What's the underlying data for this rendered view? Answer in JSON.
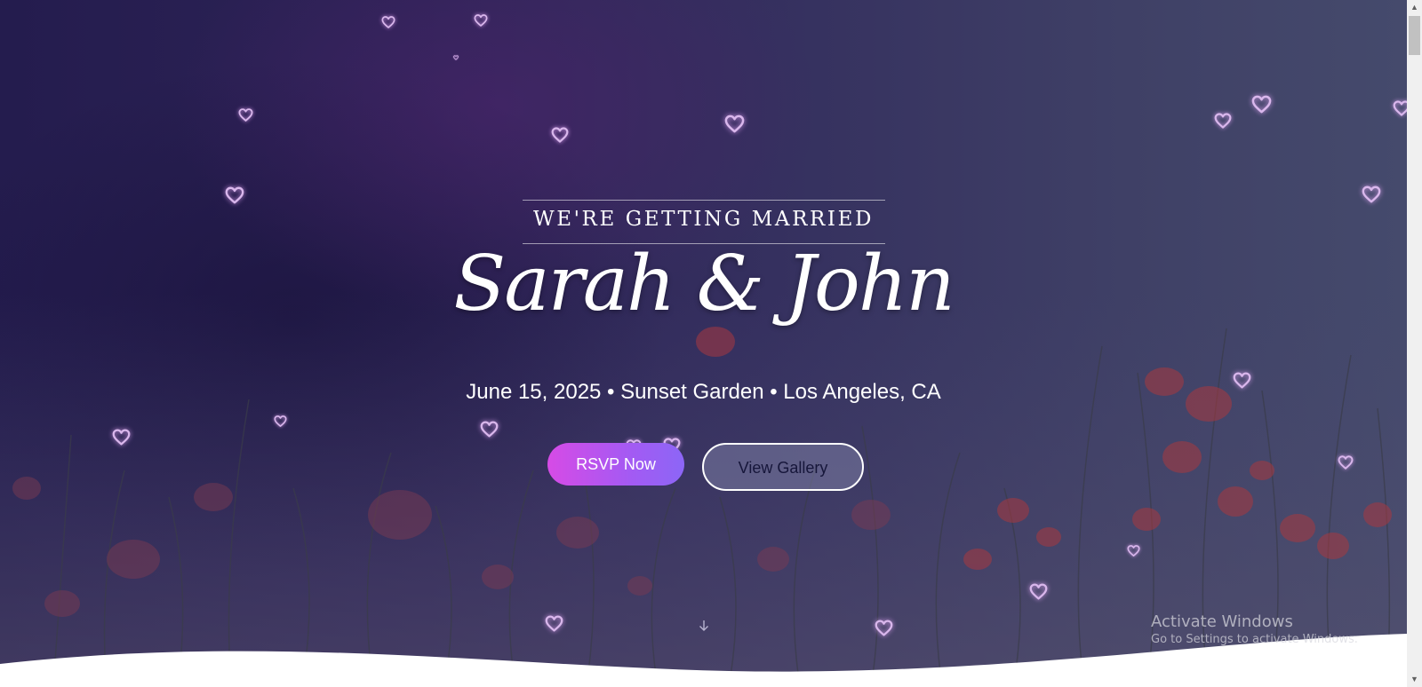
{
  "hero": {
    "eyebrow": "WE'RE GETTING MARRIED",
    "couple_names": "Sarah & John",
    "details": "June 15, 2025 • Sunset Garden • Los Angeles, CA",
    "buttons": {
      "rsvp_label": "RSVP Now",
      "gallery_label": "View Gallery"
    },
    "scroll_hint_icon": "arrow-down-icon",
    "decoration_icon": "heart-outline-icon"
  },
  "os_watermark": {
    "title": "Activate Windows",
    "subtitle": "Go to Settings to activate Windows."
  },
  "colors": {
    "accent_gradient_start": "#d64be6",
    "accent_gradient_end": "#8c66f6",
    "heart_outline": "#d9b7ec",
    "hero_background": "#2d2356"
  }
}
